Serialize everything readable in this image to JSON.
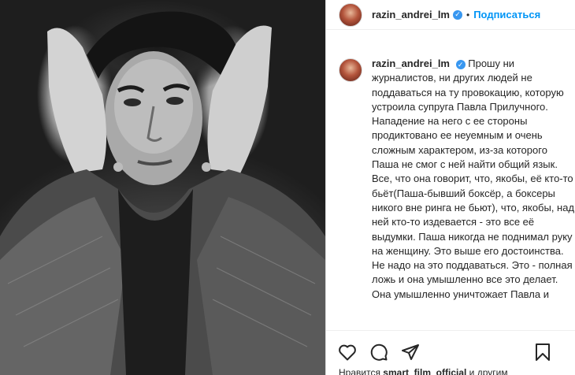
{
  "post": {
    "username": "razin_andrei_lm",
    "verified_glyph": "✓",
    "separator": "•",
    "follow_label": "Подписаться",
    "caption": "Прошу ни журналистов, ни других людей не поддаваться на ту провокацию, которую устроила супруга Павла Прилучного. Нападение на него с ее стороны продиктовано ее неуемным и очень сложным характером, из-за которого Паша не смог с ней найти общий язык. Все, что она говорит, что, якобы, её кто-то бьёт(Паша-бывший боксёр, а боксеры никого вне ринга не бьют), что, якобы, над ней кто-то издевается - это все её выдумки. Паша никогда не поднимал руку на женщину. Это выше его достоинства. Не надо на это поддаваться. Это - полная ложь и она умышленно все это делает. Она умышленно уничтожает Павла и",
    "liked_prefix": "Нравится ",
    "liked_user": "smart_film_official",
    "liked_suffix": " и другим"
  },
  "icons": {
    "like": "heart-icon",
    "comment": "comment-icon",
    "share": "share-icon",
    "save": "bookmark-icon"
  },
  "colors": {
    "accent": "#0095f6",
    "verified": "#3897f0",
    "text": "#262626"
  }
}
